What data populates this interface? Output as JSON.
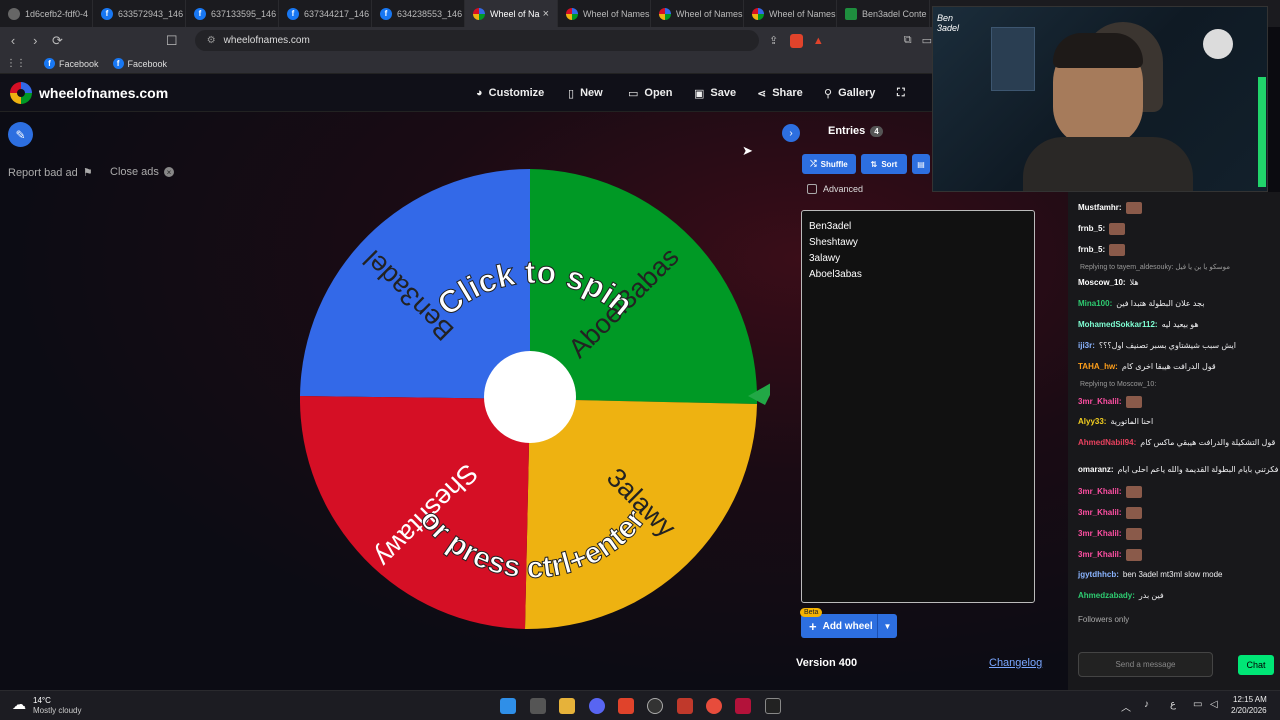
{
  "browser": {
    "tabs": [
      {
        "title": "1d6cefb2-fdf0-4",
        "icon": "globe-icon"
      },
      {
        "title": "633572943_146",
        "icon": "facebook-icon"
      },
      {
        "title": "637133595_146",
        "icon": "facebook-icon"
      },
      {
        "title": "637344217_146",
        "icon": "facebook-icon"
      },
      {
        "title": "634238553_146",
        "icon": "facebook-icon"
      },
      {
        "title": "Wheel of Na",
        "icon": "wheel-icon",
        "active": true
      },
      {
        "title": "Wheel of Names",
        "icon": "wheel-icon"
      },
      {
        "title": "Wheel of Names",
        "icon": "wheel-icon"
      },
      {
        "title": "Wheel of Names",
        "icon": "wheel-icon"
      },
      {
        "title": "Ben3adel Conte",
        "icon": "sheets-icon"
      }
    ],
    "url": "wheelofnames.com",
    "bookmarks": [
      "Facebook",
      "Facebook"
    ]
  },
  "site": {
    "logo_text": "wheelofnames.com",
    "nav": [
      "Customize",
      "New",
      "Open",
      "Save",
      "Share",
      "Gallery"
    ],
    "report_ad": "Report bad ad",
    "close_ads": "Close ads",
    "wheel": {
      "prompt_top": "Click to spin",
      "prompt_bottom": "or press ctrl+enter",
      "segments": [
        {
          "name": "Ben3adel",
          "color": "#3369e8"
        },
        {
          "name": "Aboel3abas",
          "color": "#009925"
        },
        {
          "name": "3alawy",
          "color": "#eeb211"
        },
        {
          "name": "Sheshtawy",
          "color": "#d50f25"
        }
      ]
    },
    "panel": {
      "entries_label": "Entries",
      "entries_count": "4",
      "shuffle": "Shuffle",
      "sort": "Sort",
      "advanced": "Advanced",
      "entries": [
        "Ben3adel",
        "Sheshtawy",
        "3alawy",
        "Aboel3abas"
      ],
      "beta": "Beta",
      "add_wheel": "Add wheel",
      "version": "Version 400",
      "changelog": "Changelog"
    }
  },
  "webcam": {
    "overlay_text": "Ben 3adel"
  },
  "chat": {
    "messages": [
      {
        "user": "Mustfamhr:",
        "text": "",
        "color": "#ffffff"
      },
      {
        "user": "frnb_5:",
        "text": "",
        "color": "#ffffff"
      },
      {
        "user": "frnb_5:",
        "text": "",
        "color": "#ffffff"
      },
      {
        "reply": "Replying to tayem_aldesouky: موسكو يا بن يا فيل"
      },
      {
        "user": "Moscow_10:",
        "text": "هلا",
        "color": "#ffffff"
      },
      {
        "user": "Mina100:",
        "text": "بجد علان البطولة هتبدا فين",
        "color": "#2ecc71"
      },
      {
        "user": "MohamedSokkar112:",
        "text": "هو بيعيد ليه",
        "color": "#7fffd4"
      },
      {
        "user": "iji3r:",
        "text": "ايش سبب شيشتاوي بسبر تصنيف اول؟؟؟",
        "color": "#8ab4ff"
      },
      {
        "user": "TAHA_hw:",
        "text": "قول الدرافت هيبقا اخرى كام",
        "color": "#ff9f1a"
      },
      {
        "reply": "Replying to Moscow_10:"
      },
      {
        "user": "3mr_Khalil:",
        "text": "",
        "color": "#ff4fa3"
      },
      {
        "user": "Alyy33:",
        "text": "احنا الماتورية",
        "color": "#f5d020"
      },
      {
        "user": "AhmedNabil94:",
        "text": "قول التشكيلة والدرافت هيبقي ماكس كام",
        "color": "#e8415e"
      },
      {
        "user": "omaranz:",
        "text": "فكرتني بايام البطولة القديمة والله ياعم احلى ايام",
        "color": "#ffffff"
      },
      {
        "user": "3mr_Khalil:",
        "text": "",
        "color": "#ff4fa3"
      },
      {
        "user": "3mr_Khalil:",
        "text": "",
        "color": "#ff4fa3"
      },
      {
        "user": "3mr_Khalil:",
        "text": "",
        "color": "#ff4fa3"
      },
      {
        "user": "3mr_Khalil:",
        "text": "",
        "color": "#ff4fa3"
      },
      {
        "user": "jgytdhhcb:",
        "text": "ben 3adel mt3ml slow mode",
        "color": "#8ab4ff"
      },
      {
        "user": "Ahmedzabady:",
        "text": "فين بدر",
        "color": "#2ecc71"
      }
    ],
    "followers_only": "Followers only",
    "input_placeholder": "Send a message",
    "chat_button": "Chat"
  },
  "taskbar": {
    "weather_temp": "14°C",
    "weather_desc": "Mostly cloudy",
    "lang": "ع",
    "time": "12:15 AM",
    "date": "2/20/2026"
  }
}
